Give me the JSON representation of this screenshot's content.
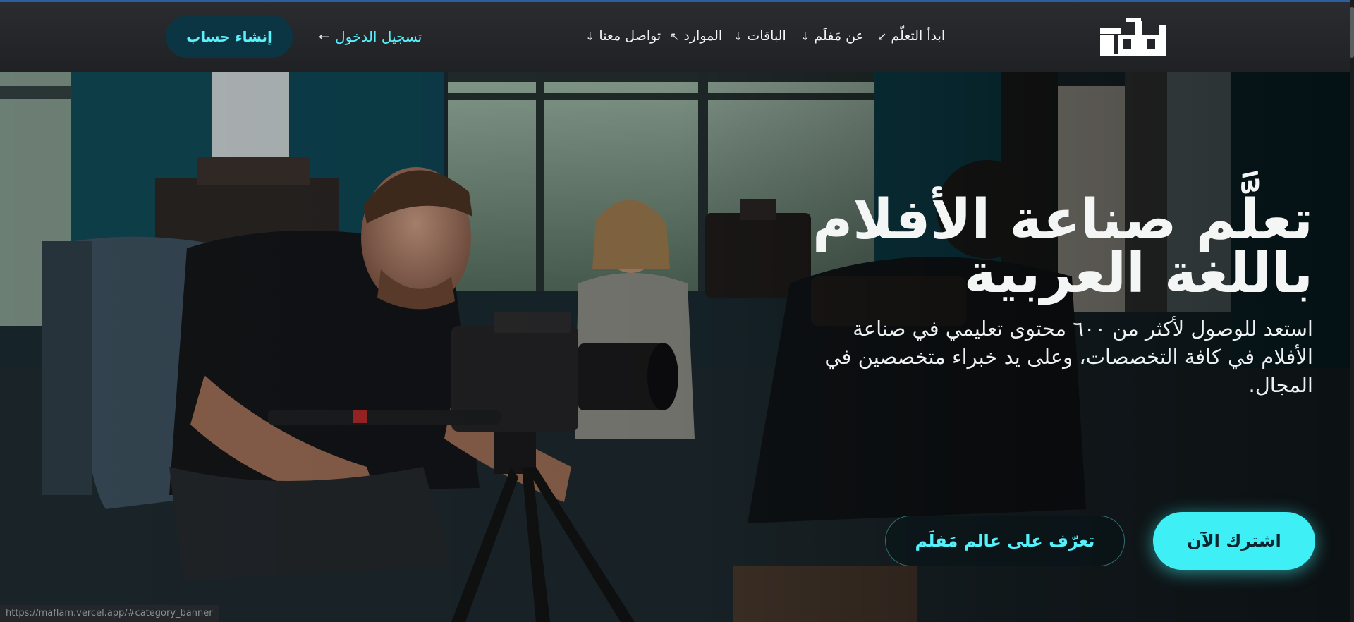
{
  "brand": {
    "logo_icon": "maflam-logo-icon",
    "logo_color": "#ffffff"
  },
  "nav": {
    "items": [
      {
        "label": "ابدأ التعلّم",
        "arrow": "↙"
      },
      {
        "label": "عن مَفلَم",
        "arrow": "↓"
      },
      {
        "label": "الباقات",
        "arrow": "↓"
      },
      {
        "label": "الموارد",
        "arrow": "↖"
      },
      {
        "label": "تواصل معنا",
        "arrow": "↓"
      }
    ]
  },
  "auth": {
    "login_label": "تسجيل الدخول",
    "login_arrow": "←",
    "signup_label": "إنشاء حساب"
  },
  "hero": {
    "title_line1": "تعلَّم صناعة الأفلام",
    "title_line2": "باللغة العربية",
    "description": "استعد للوصول لأكثر من ٦٠٠ محتوى تعليمي في صناعة الأفلام في كافة التخصصات، وعلى يد خبراء متخصصين في المجال.",
    "primary_button": "اشترك الآن",
    "secondary_button": "تعرّف على عالم مَفلَم"
  },
  "status_bar": {
    "url": "https://maflam.vercel.app/#category_banner"
  },
  "colors": {
    "accent": "#3ef0f6",
    "header_bg": "#2a2c30",
    "signup_bg": "#0c3544"
  }
}
